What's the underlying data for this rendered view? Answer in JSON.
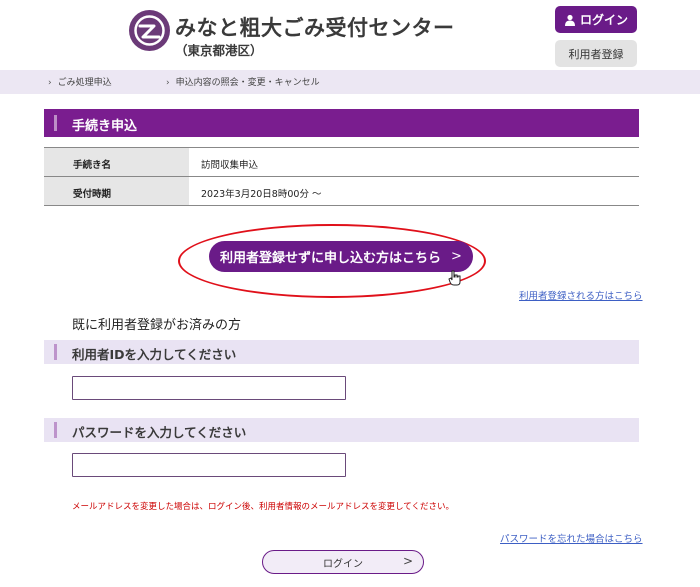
{
  "header": {
    "title": "みなと粗大ごみ受付センター",
    "subtitle": "（東京都港区）",
    "login_label": "ログイン",
    "register_label": "利用者登録"
  },
  "nav": {
    "items": [
      {
        "label": "ごみ処理申込"
      },
      {
        "label": "申込内容の照会・変更・キャンセル"
      }
    ]
  },
  "section": {
    "title": "手続き申込"
  },
  "info": {
    "rows": [
      {
        "label": "手続き名",
        "value": "訪問収集申込"
      },
      {
        "label": "受付時期",
        "value": "2023年3月20日8時00分 ～"
      }
    ]
  },
  "cta": {
    "label": "利用者登録せずに申し込む方はこちら",
    "arrow": ">"
  },
  "register_link": "利用者登録される方はこちら",
  "already_label": "既に利用者登録がお済みの方",
  "fields": {
    "user_id_label": "利用者IDを入力してください",
    "user_id_value": "",
    "password_label": "パスワードを入力してください",
    "password_value": ""
  },
  "notice": "メールアドレスを変更した場合は、ログイン後、利用者情報のメールアドレスを変更してください。",
  "forgot_password_link": "パスワードを忘れた場合はこちら",
  "submit": {
    "label": "ログイン",
    "arrow": ">"
  },
  "colors": {
    "brand": "#6a1b88",
    "highlight_ring": "#e0101a",
    "link": "#3d5fc4"
  }
}
